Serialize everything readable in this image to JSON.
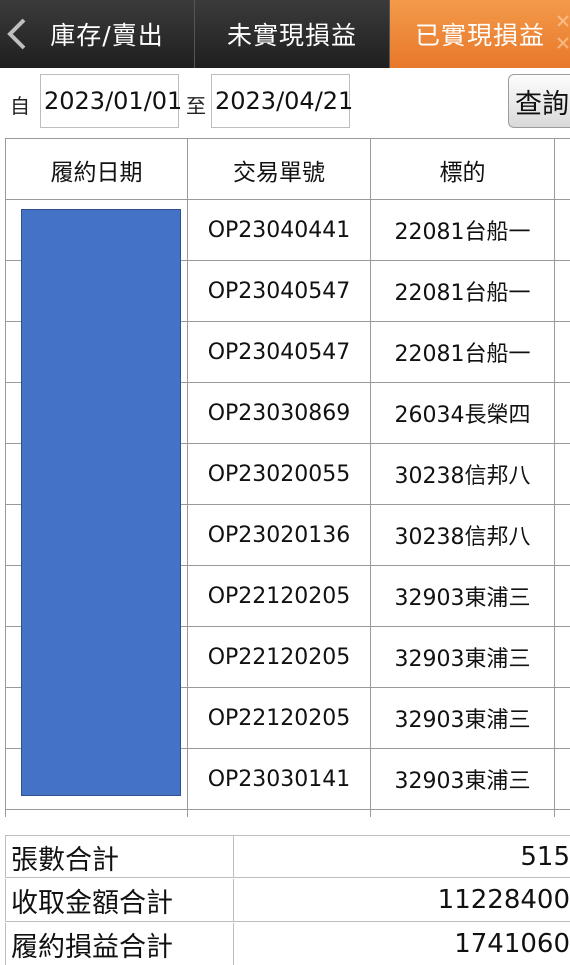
{
  "tabs": [
    {
      "label": "庫存/賣出"
    },
    {
      "label": "未實現損益"
    },
    {
      "label": "已實現損益"
    }
  ],
  "filter": {
    "from_label": "自",
    "to_label": "至",
    "start_date": "2023/01/01",
    "end_date": "2023/04/21",
    "query_label": "查詢"
  },
  "table": {
    "headers": [
      "履約日期",
      "交易單號",
      "標的"
    ],
    "rows": [
      {
        "order_no": "OP23040441",
        "target": "22081台船一"
      },
      {
        "order_no": "OP23040547",
        "target": "22081台船一"
      },
      {
        "order_no": "OP23040547",
        "target": "22081台船一"
      },
      {
        "order_no": "OP23030869",
        "target": "26034長榮四"
      },
      {
        "order_no": "OP23020055",
        "target": "30238信邦八"
      },
      {
        "order_no": "OP23020136",
        "target": "30238信邦八"
      },
      {
        "order_no": "OP22120205",
        "target": "32903東浦三"
      },
      {
        "order_no": "OP22120205",
        "target": "32903東浦三"
      },
      {
        "order_no": "OP22120205",
        "target": "32903東浦三"
      },
      {
        "order_no": "OP23030141",
        "target": "32903東浦三"
      }
    ]
  },
  "totals": [
    {
      "label": "張數合計",
      "value": "515"
    },
    {
      "label": "收取金額合計",
      "value": "11228400"
    },
    {
      "label": "履約損益合計",
      "value": "1741060"
    }
  ],
  "colors": {
    "active_tab": "#e8782b",
    "inactive_tab": "#2b2b2b",
    "redaction": "#4472c4"
  }
}
